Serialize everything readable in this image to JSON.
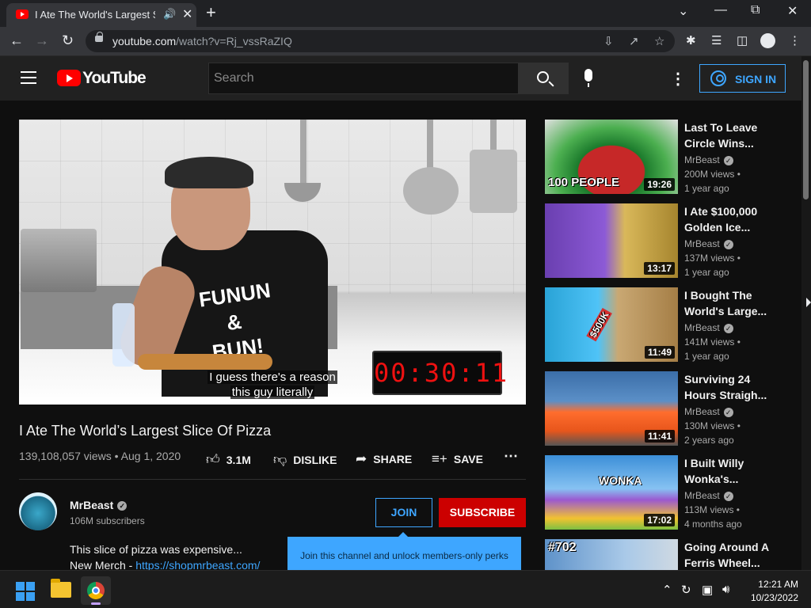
{
  "browser": {
    "tab_title": "I Ate The World's Largest Slice Of Pizza",
    "tab_audio_icon": "speaker-icon",
    "new_tab_symbol": "+",
    "url_host": "youtube.com",
    "url_path": "/watch?v=Rj_vssRaZIQ"
  },
  "youtube": {
    "logo_text": "YouTube",
    "search_placeholder": "Search",
    "sign_in_label": "SIGN IN",
    "accent_color": "#3ea6ff",
    "brand_color": "#ff0000"
  },
  "video": {
    "caption_line1": "I guess there's a reason",
    "caption_line2": "this guy literally",
    "timer": "00:30:11",
    "shirt_text_line1": "FUNUN",
    "shirt_text_line2": "& BUN!",
    "title": "I Ate The World’s Largest Slice Of Pizza",
    "meta": "139,108,057 views • Aug 1, 2020",
    "actions": {
      "like": "3.1M",
      "dislike": "DISLIKE",
      "share": "SHARE",
      "save": "SAVE"
    }
  },
  "channel": {
    "name": "MrBeast",
    "subscribers": "106M subscribers",
    "join_label": "JOIN",
    "subscribe_label": "SUBSCRIBE",
    "join_tooltip": "Join this channel and unlock members-only perks",
    "description_line1": "This slice of pizza was expensive...",
    "description_prefix": "New Merch - ",
    "description_link": "https://shopmrbeast.com/"
  },
  "recommendations": [
    {
      "title": "Last To Leave Circle Wins...",
      "channel": "MrBeast",
      "views": "200M views •",
      "age": "1 year ago",
      "duration": "19:26",
      "overlay": "100 PEOPLE"
    },
    {
      "title": "I Ate $100,000 Golden Ice...",
      "channel": "MrBeast",
      "views": "137M views •",
      "age": "1 year ago",
      "duration": "13:17",
      "overlay": ""
    },
    {
      "title": "I Bought The World's Large...",
      "channel": "MrBeast",
      "views": "141M views •",
      "age": "1 year ago",
      "duration": "11:49",
      "overlay": "$500K"
    },
    {
      "title": "Surviving 24 Hours Straigh...",
      "channel": "MrBeast",
      "views": "130M views •",
      "age": "2 years ago",
      "duration": "11:41",
      "overlay": ""
    },
    {
      "title": "I Built Willy Wonka's...",
      "channel": "MrBeast",
      "views": "113M views •",
      "age": "4 months ago",
      "duration": "17:02",
      "overlay": "WONKA"
    },
    {
      "title": "Going Around A Ferris Wheel...",
      "channel": "",
      "views": "",
      "age": "",
      "duration": "",
      "overlay": "#702"
    }
  ],
  "taskbar": {
    "time": "12:21 AM",
    "date": "10/23/2022"
  }
}
